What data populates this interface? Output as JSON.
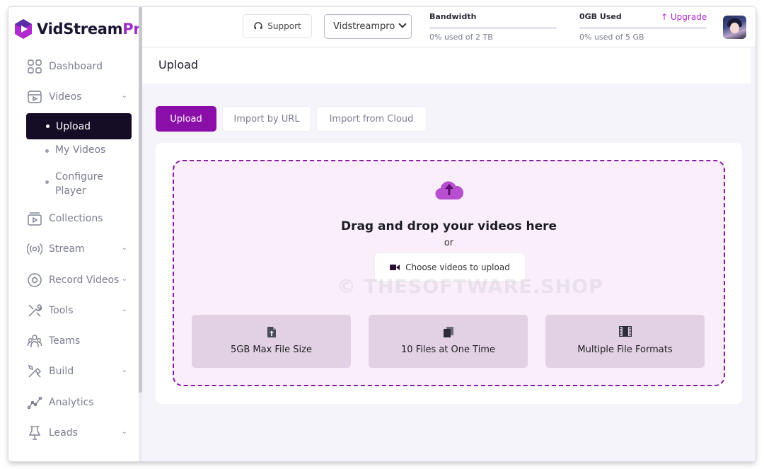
{
  "app": {
    "logo_text": "VidStream",
    "logo_suffix": "Pro"
  },
  "sidebar": {
    "items": [
      {
        "label": "Dashboard",
        "icon": "grid-icon"
      },
      {
        "label": "Videos",
        "icon": "video-icon",
        "expanded": true
      },
      {
        "label": "Collections",
        "icon": "collection-icon"
      },
      {
        "label": "Stream",
        "icon": "broadcast-icon"
      },
      {
        "label": "Record Videos",
        "icon": "record-icon"
      },
      {
        "label": "Tools",
        "icon": "tools-icon"
      },
      {
        "label": "Teams",
        "icon": "teams-icon"
      },
      {
        "label": "Build",
        "icon": "build-icon"
      },
      {
        "label": "Analytics",
        "icon": "analytics-icon"
      },
      {
        "label": "Leads",
        "icon": "leads-icon"
      }
    ],
    "subitems": [
      {
        "label": "Upload",
        "active": true
      },
      {
        "label": "My Videos"
      },
      {
        "label": "Configure",
        "label2": "Player"
      }
    ]
  },
  "topbar": {
    "support_label": "Support",
    "workspace_selected": "Vidstreampro",
    "bandwidth_label": "Bandwidth",
    "bandwidth_usage": "0% used of 2 TB",
    "bandwidth_fraction": 0,
    "storage_label": "0GB Used",
    "storage_usage": "0% used of 5 GB",
    "storage_fraction": 0,
    "upgrade_label": "Upgrade"
  },
  "page": {
    "title": "Upload",
    "tabs": [
      {
        "label": "Upload",
        "active": true
      },
      {
        "label": "Import by URL"
      },
      {
        "label": "Import from Cloud"
      }
    ]
  },
  "dropzone": {
    "title": "Drag and drop your videos here",
    "or_text": "or",
    "choose_label": "Choose videos to upload",
    "features": [
      {
        "label": "5GB Max File Size",
        "icon": "file-upload-icon"
      },
      {
        "label": "10 Files at One Time",
        "icon": "files-icon"
      },
      {
        "label": "Multiple File Formats",
        "icon": "film-icon"
      }
    ]
  },
  "watermark": "© THESOFTWARE.SHOP",
  "colors": {
    "accent": "#8a0fa8",
    "sidebar_active": "#150c26",
    "dropzone_bg": "#f9eefa",
    "feature_bg": "#e2d0e5"
  }
}
